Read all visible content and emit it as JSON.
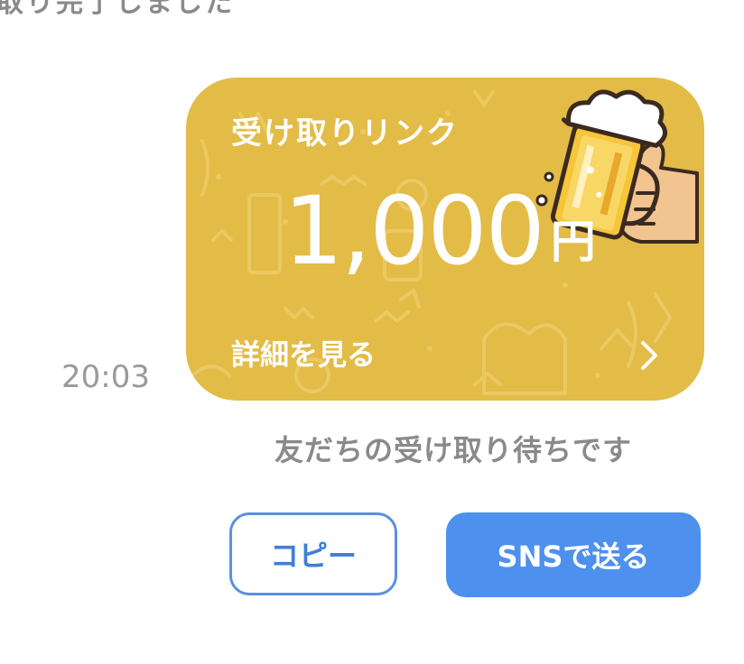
{
  "header": {
    "partial_text": "取り完了しました"
  },
  "message": {
    "timestamp": "20:03",
    "status": "友だちの受け取り待ちです"
  },
  "card": {
    "title": "受け取りリンク",
    "amount": "1,000",
    "currency": "円",
    "details_label": "詳細を見る",
    "background_color": "#e3bb47"
  },
  "actions": {
    "copy_label": "コピー",
    "sns_label": "SNSで送る",
    "primary_color": "#4e90ee"
  },
  "icons": {
    "chevron": "chevron-right-icon",
    "beer": "beer-mug-icon"
  }
}
